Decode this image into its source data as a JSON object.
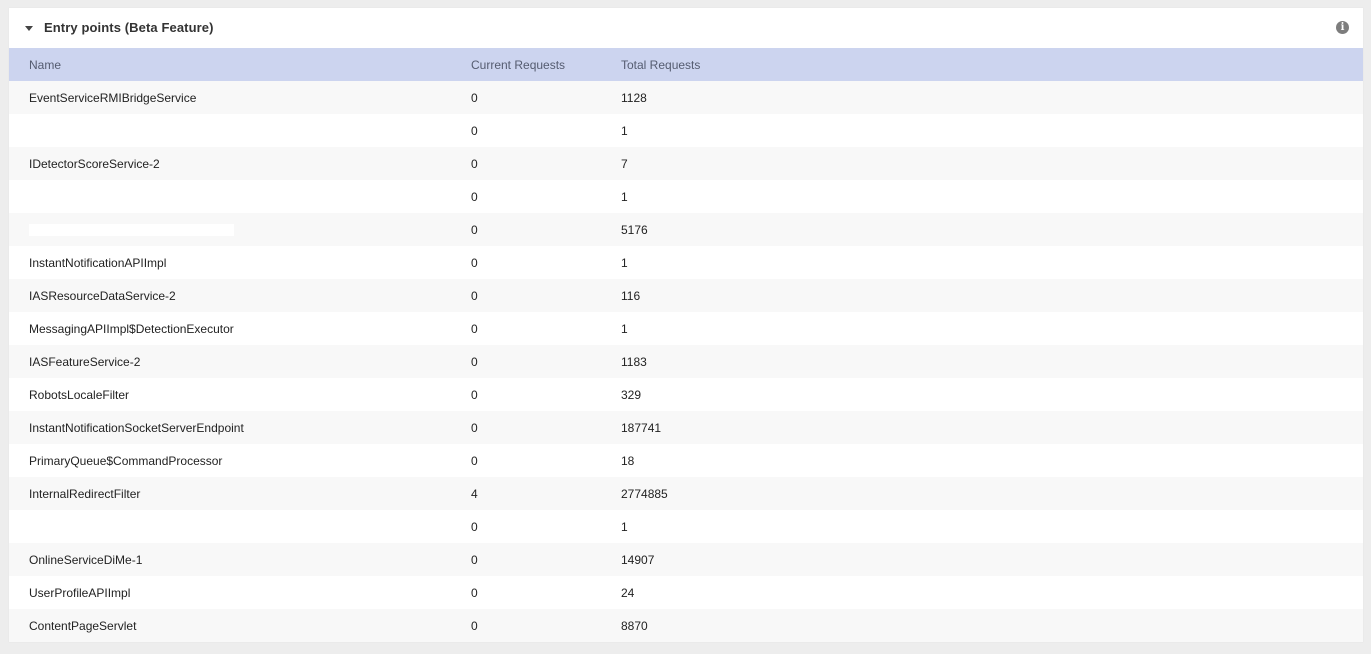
{
  "panel": {
    "title": "Entry points (Beta Feature)",
    "info_icon": "info-icon",
    "collapse_icon": "caret-down-icon"
  },
  "table": {
    "columns": [
      "Name",
      "Current Requests",
      "Total Requests"
    ],
    "rows": [
      {
        "name": "EventServiceRMIBridgeService",
        "current": "0",
        "total": "1128"
      },
      {
        "name": "",
        "current": "0",
        "total": "1"
      },
      {
        "name": "IDetectorScoreService-2",
        "current": "0",
        "total": "7"
      },
      {
        "name": "",
        "current": "0",
        "total": "1"
      },
      {
        "name": "",
        "current": "0",
        "total": "5176",
        "redacted": true
      },
      {
        "name": "InstantNotificationAPIImpl",
        "current": "0",
        "total": "1"
      },
      {
        "name": "IASResourceDataService-2",
        "current": "0",
        "total": "116"
      },
      {
        "name": "MessagingAPIImpl$DetectionExecutor",
        "current": "0",
        "total": "1"
      },
      {
        "name": "IASFeatureService-2",
        "current": "0",
        "total": "1183"
      },
      {
        "name": "RobotsLocaleFilter",
        "current": "0",
        "total": "329"
      },
      {
        "name": "InstantNotificationSocketServerEndpoint",
        "current": "0",
        "total": "187741"
      },
      {
        "name": "PrimaryQueue$CommandProcessor",
        "current": "0",
        "total": "18"
      },
      {
        "name": "InternalRedirectFilter",
        "current": "4",
        "total": "2774885"
      },
      {
        "name": "",
        "current": "0",
        "total": "1"
      },
      {
        "name": "OnlineServiceDiMe-1",
        "current": "0",
        "total": "14907"
      },
      {
        "name": "UserProfileAPIImpl",
        "current": "0",
        "total": "24"
      },
      {
        "name": "ContentPageServlet",
        "current": "0",
        "total": "8870"
      }
    ]
  },
  "colors": {
    "header_bg": "#ccd4ef",
    "row_alt": "#f8f8f8",
    "page_bg": "#ededed"
  }
}
